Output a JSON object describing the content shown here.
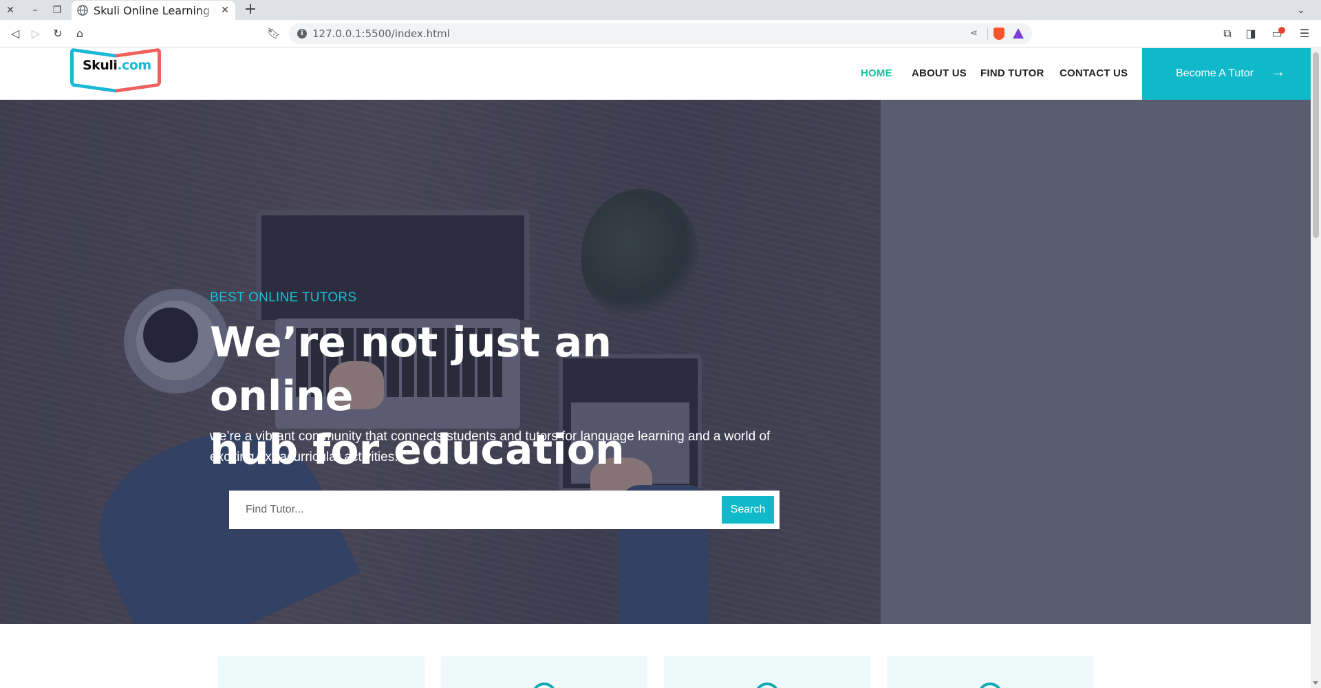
{
  "browser": {
    "tab_title": "Skuli Online Learning Pl",
    "url": "127.0.0.1:5500/index.html"
  },
  "header": {
    "logo_text_main": "Skuli",
    "logo_text_suffix": ".com",
    "nav": [
      {
        "label": "HOME",
        "active": true
      },
      {
        "label": "ABOUT US",
        "active": false
      },
      {
        "label": "FIND TUTOR",
        "active": false
      },
      {
        "label": "CONTACT US",
        "active": false
      }
    ],
    "cta_label": "Become A Tutor",
    "cta_icon": "arrow-right-icon"
  },
  "hero": {
    "eyebrow": "BEST ONLINE TUTORS",
    "title_line1": "We’re not just an online",
    "title_line2": "hub for education",
    "subtitle": "we’re a vibrant community that connects students and tutors for language learning and a world of exciting extracurricular activities.",
    "search_placeholder": "Find Tutor...",
    "search_button": "Search"
  },
  "colors": {
    "accent": "#0fb9c9",
    "nav_active": "#1bbfa0",
    "eyebrow": "#19c1d6"
  }
}
